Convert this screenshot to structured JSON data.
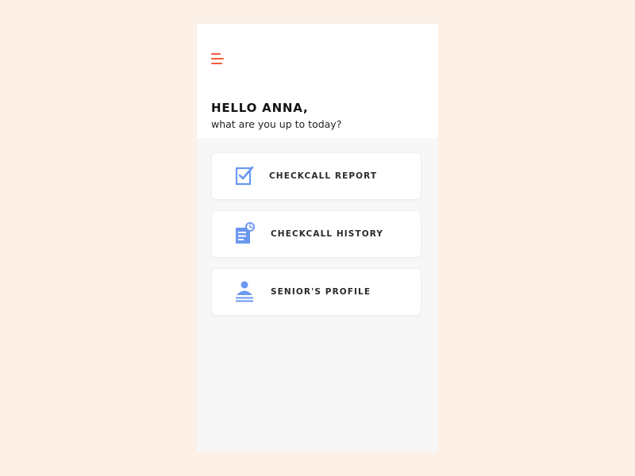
{
  "header": {
    "greeting": "HELLO ANNA,",
    "subtitle": "what are you up to today?"
  },
  "menu": {
    "icon": "hamburger-menu-icon",
    "accent_color": "#ef5a3c"
  },
  "cards": [
    {
      "label": "CHECKCALL REPORT",
      "icon": "clipboard-check-icon"
    },
    {
      "label": "CHECKCALL HISTORY",
      "icon": "document-clock-icon"
    },
    {
      "label": "SENIOR'S PROFILE",
      "icon": "person-profile-icon"
    }
  ],
  "colors": {
    "icon_blue": "#6a98f0",
    "background": "#fdf0e7",
    "panel": "#f7f7f7"
  }
}
